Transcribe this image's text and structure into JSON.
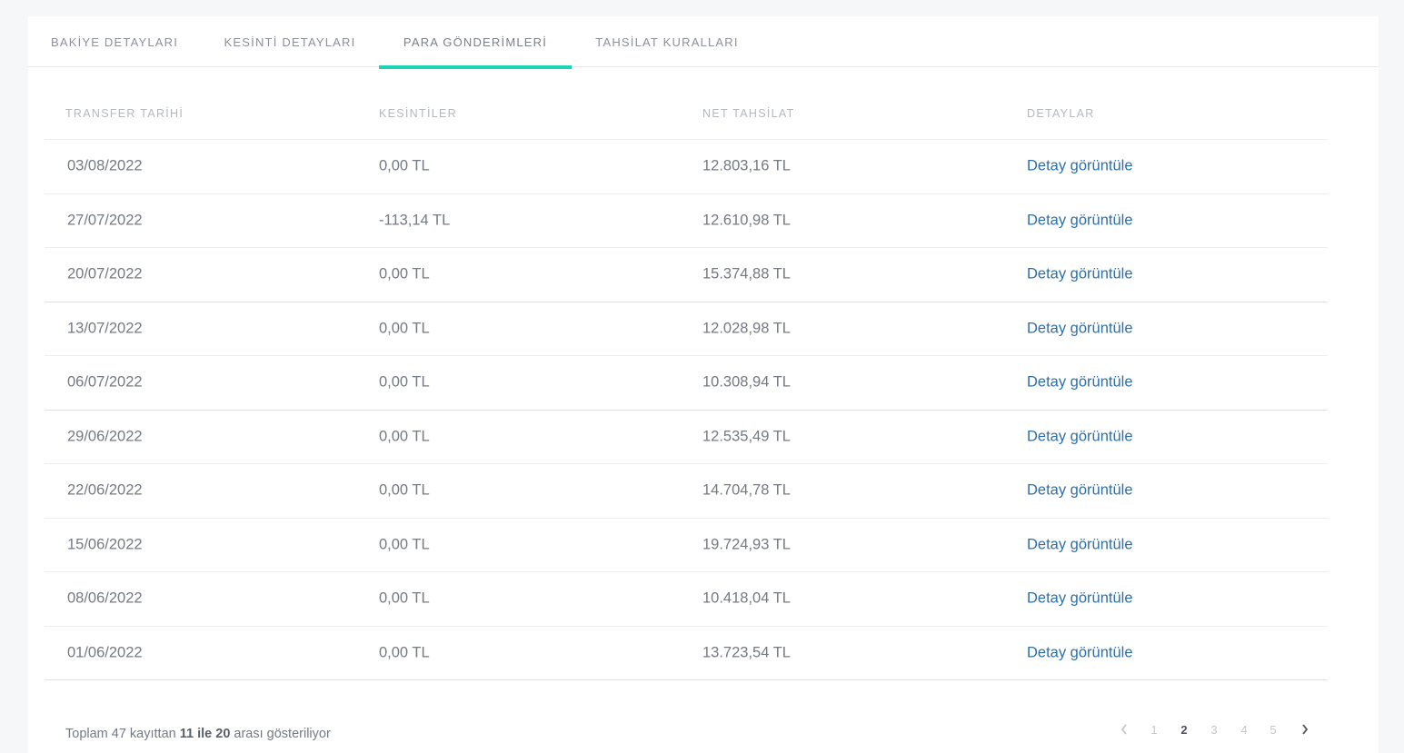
{
  "tabs": [
    {
      "label": "BAKİYE DETAYLARI"
    },
    {
      "label": "KESİNTİ DETAYLARI"
    },
    {
      "label": "PARA GÖNDERİMLERİ"
    },
    {
      "label": "TAHSİLAT KURALLARI"
    }
  ],
  "active_tab": "PARA GÖNDERİMLERİ",
  "accent_color": "#1fd5b1",
  "link_color": "#2e6fa8",
  "table": {
    "columns": [
      "TRANSFER TARİHİ",
      "KESİNTİLER",
      "NET TAHSİLAT",
      "DETAYLAR"
    ],
    "rows": [
      {
        "date": "03/08/2022",
        "deductions": "0,00 TL",
        "net": "12.803,16 TL",
        "details": "Detay görüntüle"
      },
      {
        "date": "27/07/2022",
        "deductions": "-113,14 TL",
        "net": "12.610,98 TL",
        "details": "Detay görüntüle"
      },
      {
        "date": "20/07/2022",
        "deductions": "0,00 TL",
        "net": "15.374,88 TL",
        "details": "Detay görüntüle"
      },
      {
        "date": "13/07/2022",
        "deductions": "0,00 TL",
        "net": "12.028,98 TL",
        "details": "Detay görüntüle"
      },
      {
        "date": "06/07/2022",
        "deductions": "0,00 TL",
        "net": "10.308,94 TL",
        "details": "Detay görüntüle"
      },
      {
        "date": "29/06/2022",
        "deductions": "0,00 TL",
        "net": "12.535,49 TL",
        "details": "Detay görüntüle"
      },
      {
        "date": "22/06/2022",
        "deductions": "0,00 TL",
        "net": "14.704,78 TL",
        "details": "Detay görüntüle"
      },
      {
        "date": "15/06/2022",
        "deductions": "0,00 TL",
        "net": "19.724,93 TL",
        "details": "Detay görüntüle"
      },
      {
        "date": "08/06/2022",
        "deductions": "0,00 TL",
        "net": "10.418,04 TL",
        "details": "Detay görüntüle"
      },
      {
        "date": "01/06/2022",
        "deductions": "0,00 TL",
        "net": "13.723,54 TL",
        "details": "Detay görüntüle"
      }
    ]
  },
  "footer": {
    "prefix": "Toplam 47 kayıttan ",
    "range": "11 ile 20",
    "suffix": " arası gösteriliyor"
  },
  "pagination": {
    "pages": [
      "1",
      "2",
      "3",
      "4",
      "5"
    ],
    "current": "2",
    "prev_icon": "chevron-left-icon",
    "next_icon": "chevron-right-icon"
  }
}
